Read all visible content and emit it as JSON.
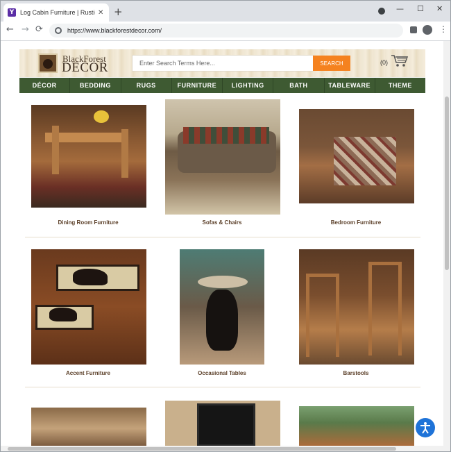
{
  "browser": {
    "tab_title": "Log Cabin Furniture | Rustic Furni",
    "favicon_letter": "Y",
    "tab_close": "✕",
    "new_tab": "+",
    "url": "https://www.blackforestdecor.com/",
    "back": "←",
    "forward": "→",
    "reload": "⟳",
    "minimize": "—",
    "maximize": "☐",
    "close": "✕",
    "menu": "⋮"
  },
  "site": {
    "logo_line1": "BlackForest",
    "logo_line2": "DECOR",
    "search_placeholder": "Enter Search Terms Here...",
    "search_button": "SEARCH",
    "cart_count": "(0)",
    "brand_color": "#3e5a32",
    "accent_color": "#f5821f"
  },
  "nav": [
    "DÉCOR",
    "BEDDING",
    "RUGS",
    "FURNITURE",
    "LIGHTING",
    "BATH",
    "TABLEWARE",
    "THEME"
  ],
  "categories": [
    {
      "label": "Dining Room Furniture"
    },
    {
      "label": "Sofas & Chairs"
    },
    {
      "label": "Bedroom Furniture"
    },
    {
      "label": "Accent Furniture"
    },
    {
      "label": "Occasional Tables"
    },
    {
      "label": "Barstools"
    }
  ],
  "icons": {
    "accessibility": "accessibility-icon",
    "cart": "cart-icon",
    "extensions": "puzzle-icon",
    "profile": "profile-icon"
  }
}
